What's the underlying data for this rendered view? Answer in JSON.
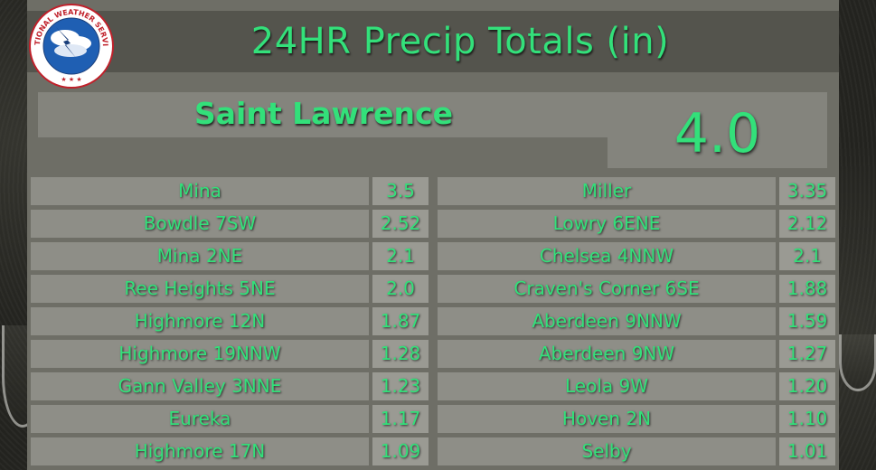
{
  "title": "24HR Precip Totals (in)",
  "featured": {
    "location": "Saint Lawrence",
    "value": "4.0"
  },
  "logo": {
    "text": "NATIONAL WEATHER SERVICE",
    "icon": "nws-logo-icon"
  },
  "left_column": [
    {
      "location": "Mina",
      "value": "3.5"
    },
    {
      "location": "Bowdle 7SW",
      "value": "2.52"
    },
    {
      "location": "Mina 2NE",
      "value": "2.1"
    },
    {
      "location": "Ree Heights 5NE",
      "value": "2.0"
    },
    {
      "location": "Highmore 12N",
      "value": "1.87"
    },
    {
      "location": "Highmore 19NNW",
      "value": "1.28"
    },
    {
      "location": "Gann Valley 3NNE",
      "value": "1.23"
    },
    {
      "location": "Eureka",
      "value": "1.17"
    },
    {
      "location": "Highmore 17N",
      "value": "1.09"
    }
  ],
  "right_column": [
    {
      "location": "Miller",
      "value": "3.35"
    },
    {
      "location": "Lowry 6ENE",
      "value": "2.12"
    },
    {
      "location": "Chelsea 4NNW",
      "value": "2.1"
    },
    {
      "location": "Craven's Corner 6SE",
      "value": "1.88"
    },
    {
      "location": "Aberdeen 9NNW",
      "value": "1.59"
    },
    {
      "location": "Aberdeen 9NW",
      "value": "1.27"
    },
    {
      "location": "Leola 9W",
      "value": "1.20"
    },
    {
      "location": "Hoven 2N",
      "value": "1.10"
    },
    {
      "location": "Selby",
      "value": "1.01"
    }
  ],
  "colors": {
    "accent": "#33e07a",
    "panel": "#6e6e66",
    "title_bar": "#54544d"
  }
}
